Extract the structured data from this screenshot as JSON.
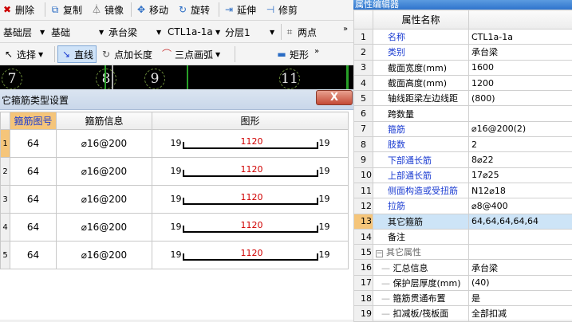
{
  "toolbar1": {
    "delete": "删除",
    "copy": "复制",
    "mirror": "镜像",
    "move": "移动",
    "rotate": "旋转",
    "extend": "延伸",
    "trim": "修剪"
  },
  "toolbar2": {
    "layer": "基础层",
    "category": "基础",
    "component_type": "承台梁",
    "component_name": "CTL1a-1a",
    "sub_layer": "分层1",
    "two_point": "两点",
    "more": "»"
  },
  "toolbar3": {
    "select": "选择",
    "line": "直线",
    "point_length": "点加长度",
    "arc": "三点画弧",
    "rect": "矩形",
    "more": "»"
  },
  "canvas": {
    "axes": [
      "7",
      "8",
      "9",
      "11"
    ]
  },
  "dialog": {
    "title": "它箍筋类型设置",
    "close": "X",
    "columns": [
      "箍筋图号",
      "箍筋信息",
      "图形"
    ],
    "rows": [
      {
        "row": "1",
        "code": "64",
        "info": "⌀16@200",
        "left": "19",
        "length": "1120",
        "right": "19"
      },
      {
        "row": "2",
        "code": "64",
        "info": "⌀16@200",
        "left": "19",
        "length": "1120",
        "right": "19"
      },
      {
        "row": "3",
        "code": "64",
        "info": "⌀16@200",
        "left": "19",
        "length": "1120",
        "right": "19"
      },
      {
        "row": "4",
        "code": "64",
        "info": "⌀16@200",
        "left": "19",
        "length": "1120",
        "right": "19"
      },
      {
        "row": "5",
        "code": "64",
        "info": "⌀16@200",
        "left": "19",
        "length": "1120",
        "right": "19"
      }
    ]
  },
  "props": {
    "title": "属性编辑器",
    "header_name": "属性名称",
    "rows": [
      {
        "n": "1",
        "name": "名称",
        "value": "CTL1a-1a",
        "style": "blue"
      },
      {
        "n": "2",
        "name": "类别",
        "value": "承台梁",
        "style": "blue"
      },
      {
        "n": "3",
        "name": "截面宽度(mm)",
        "value": "1600",
        "style": ""
      },
      {
        "n": "4",
        "name": "截面高度(mm)",
        "value": "1200",
        "style": ""
      },
      {
        "n": "5",
        "name": "轴线距梁左边线距",
        "value": "(800)",
        "style": ""
      },
      {
        "n": "6",
        "name": "跨数量",
        "value": "",
        "style": ""
      },
      {
        "n": "7",
        "name": "箍筋",
        "value": "⌀16@200(2)",
        "style": "blue"
      },
      {
        "n": "8",
        "name": "肢数",
        "value": "2",
        "style": "blue"
      },
      {
        "n": "9",
        "name": "下部通长筋",
        "value": "8⌀22",
        "style": "blue"
      },
      {
        "n": "10",
        "name": "上部通长筋",
        "value": "17⌀25",
        "style": "blue"
      },
      {
        "n": "11",
        "name": "侧面构造或受扭筋",
        "value": "N12⌀18",
        "style": "blue"
      },
      {
        "n": "12",
        "name": "拉筋",
        "value": "⌀8@400",
        "style": "blue"
      },
      {
        "n": "13",
        "name": "其它箍筋",
        "value": "64,64,64,64,64",
        "style": "sel"
      },
      {
        "n": "14",
        "name": "备注",
        "value": "",
        "style": ""
      },
      {
        "n": "15",
        "name": "其它属性",
        "value": "",
        "style": "group"
      },
      {
        "n": "16",
        "name": "汇总信息",
        "value": "承台梁",
        "style": "child"
      },
      {
        "n": "17",
        "name": "保护层厚度(mm)",
        "value": "(40)",
        "style": "child"
      },
      {
        "n": "18",
        "name": "箍筋贯通布置",
        "value": "是",
        "style": "child"
      },
      {
        "n": "19",
        "name": "扣减板/筏板面",
        "value": "全部扣减",
        "style": "child"
      }
    ]
  }
}
